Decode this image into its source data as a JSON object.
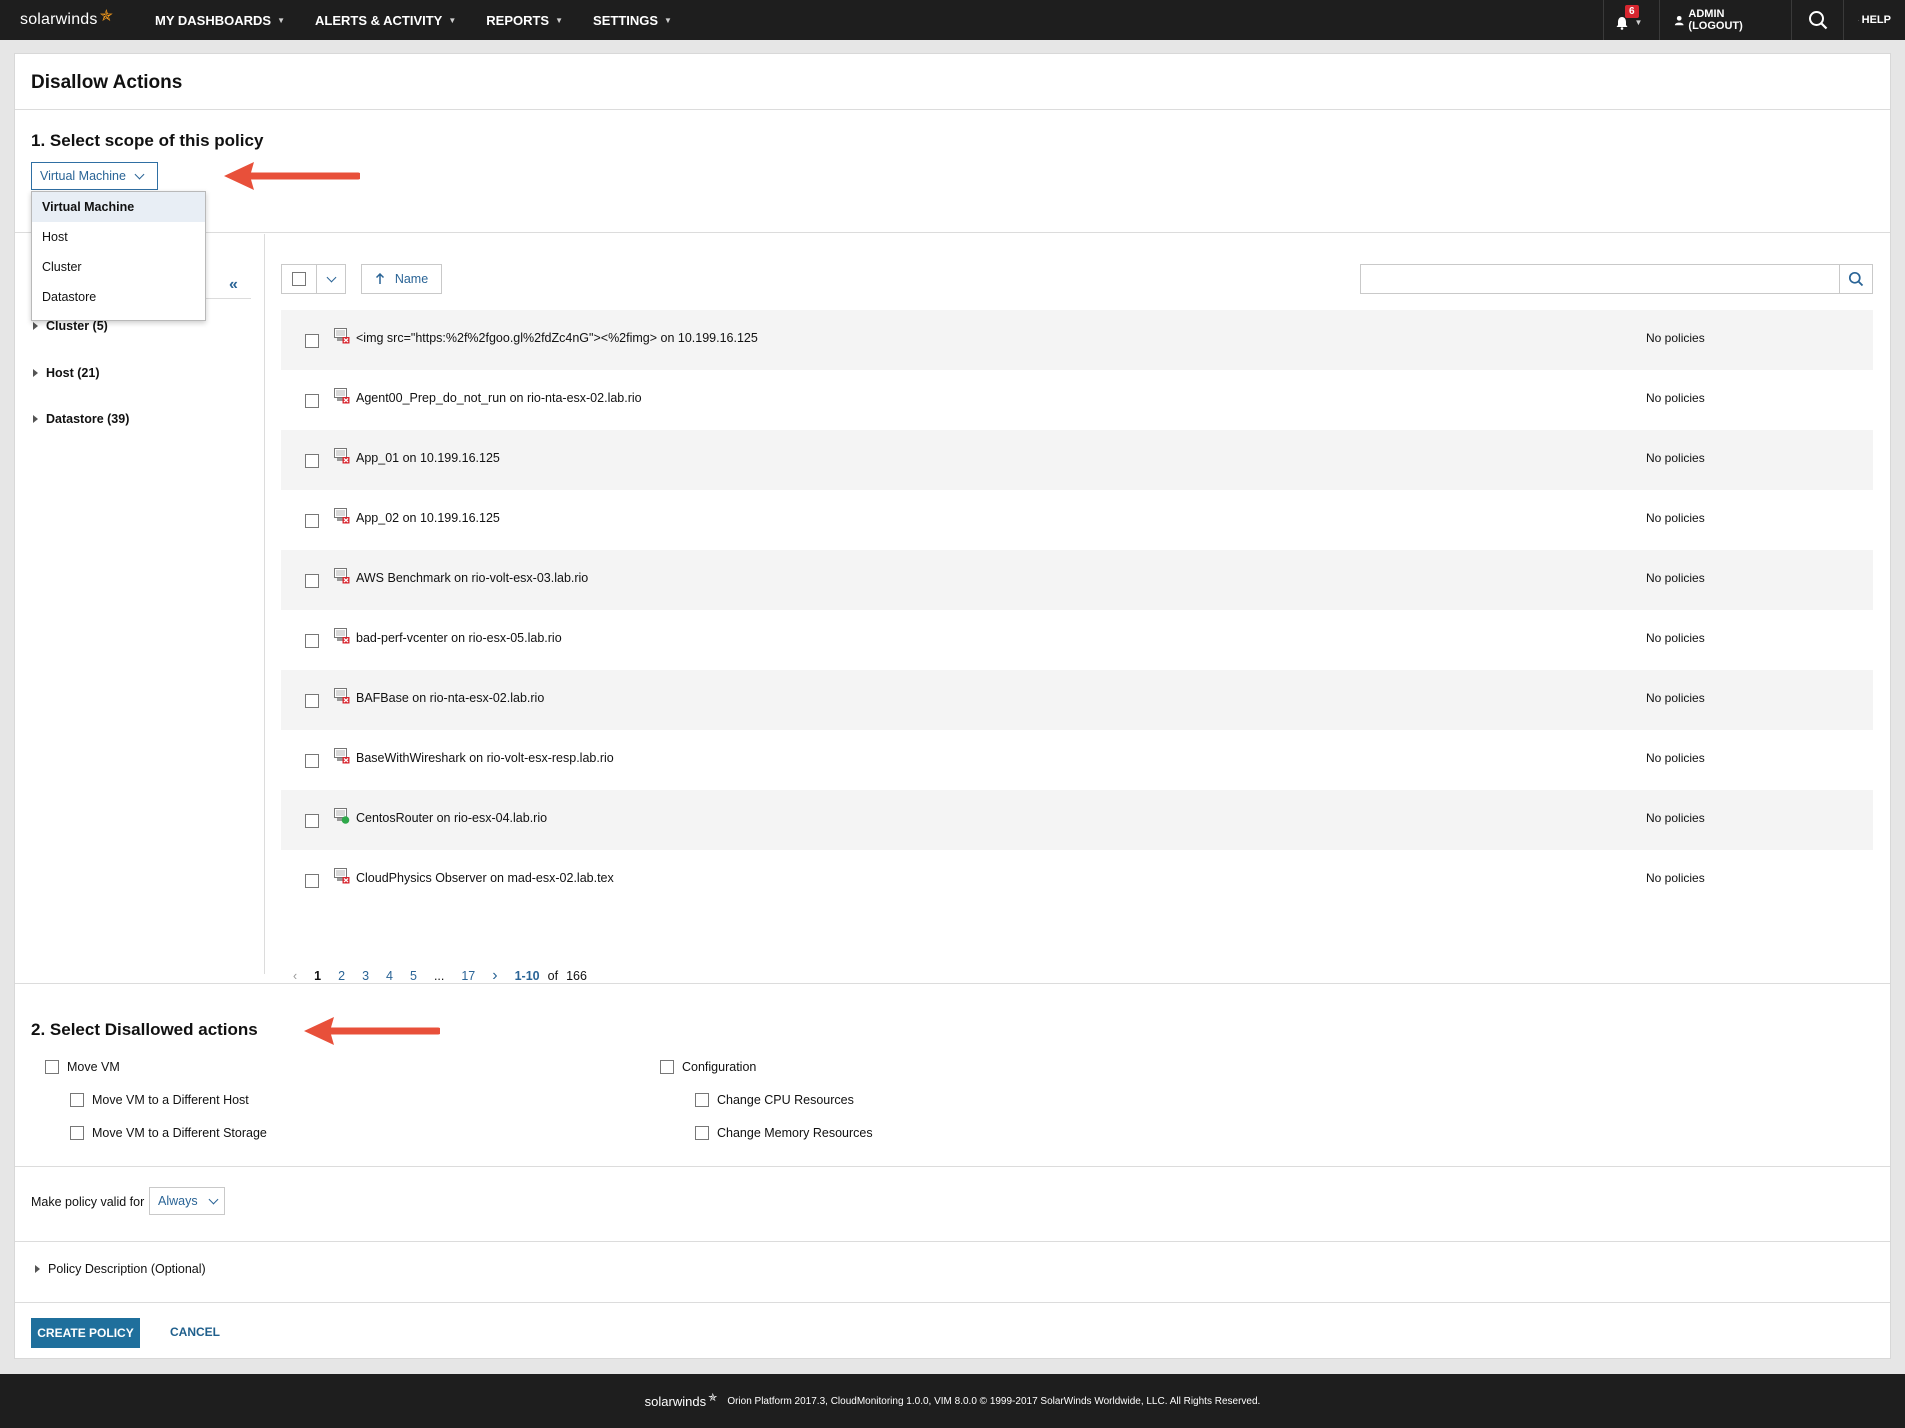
{
  "nav": {
    "logo_text": "solarwinds",
    "items": [
      "MY DASHBOARDS",
      "ALERTS & ACTIVITY",
      "REPORTS",
      "SETTINGS"
    ],
    "notification_count": "6",
    "admin_label": "ADMIN (LOGOUT)",
    "help_label": "HELP"
  },
  "page": {
    "title": "Disallow Actions",
    "section1_title": "1. Select scope of this policy",
    "section2_title": "2. Select Disallowed actions"
  },
  "scope": {
    "selected": "Virtual Machine",
    "options": [
      "Virtual Machine",
      "Host",
      "Cluster",
      "Datastore"
    ]
  },
  "tree": {
    "items": [
      "Cluster (5)",
      "Host (21)",
      "Datastore (39)"
    ]
  },
  "grid": {
    "sort_label": "Name",
    "rows": [
      {
        "name": "<img src=\"https:%2f%2fgoo.gl%2fdZc4nG\"><%2fimg> on 10.199.16.125",
        "policies": "No policies",
        "status": "error"
      },
      {
        "name": "Agent00_Prep_do_not_run on rio-nta-esx-02.lab.rio",
        "policies": "No policies",
        "status": "error"
      },
      {
        "name": "App_01 on 10.199.16.125",
        "policies": "No policies",
        "status": "error"
      },
      {
        "name": "App_02 on 10.199.16.125",
        "policies": "No policies",
        "status": "error"
      },
      {
        "name": "AWS Benchmark on rio-volt-esx-03.lab.rio",
        "policies": "No policies",
        "status": "error"
      },
      {
        "name": "bad-perf-vcenter on rio-esx-05.lab.rio",
        "policies": "No policies",
        "status": "error"
      },
      {
        "name": "BAFBase on rio-nta-esx-02.lab.rio",
        "policies": "No policies",
        "status": "error"
      },
      {
        "name": "BaseWithWireshark on rio-volt-esx-resp.lab.rio",
        "policies": "No policies",
        "status": "error"
      },
      {
        "name": "CentosRouter on rio-esx-04.lab.rio",
        "policies": "No policies",
        "status": "up"
      },
      {
        "name": "CloudPhysics Observer on mad-esx-02.lab.tex",
        "policies": "No policies",
        "status": "error"
      }
    ]
  },
  "pager": {
    "pages": [
      "1",
      "2",
      "3",
      "4",
      "5",
      "...",
      "17"
    ],
    "range": "1-10",
    "of": "of",
    "total": "166"
  },
  "actions": {
    "move_vm": "Move VM",
    "move_host": "Move VM to a Different Host",
    "move_storage": "Move VM to a Different Storage",
    "configuration": "Configuration",
    "change_cpu": "Change CPU Resources",
    "change_memory": "Change Memory Resources"
  },
  "validity": {
    "label": "Make policy valid for",
    "value": "Always"
  },
  "description_label": "Policy Description (Optional)",
  "buttons": {
    "create": "CREATE POLICY",
    "cancel": "CANCEL"
  },
  "footer": {
    "logo": "solarwinds",
    "text": "Orion Platform 2017.3, CloudMonitoring 1.0.0, VIM 8.0.0 © 1999-2017 SolarWinds Worldwide, LLC. All Rights Reserved."
  },
  "colors": {
    "accent": "#2a6496",
    "primary_button": "#1f6f9c",
    "nav_bg": "#1e1e1e",
    "annotation_arrow": "#e8503a",
    "status_up": "#2ea84a",
    "status_error": "#d8262f"
  }
}
